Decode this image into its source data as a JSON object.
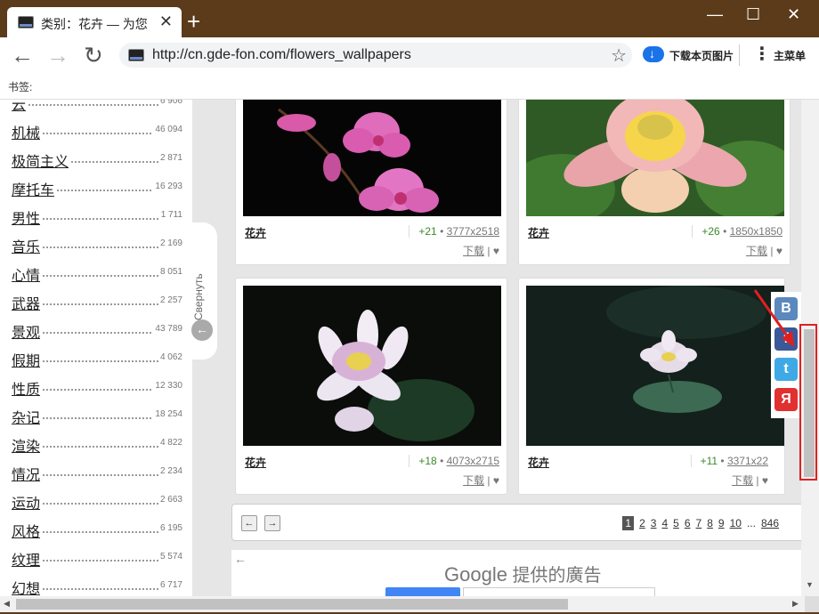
{
  "window": {
    "tab_title": "类别：花卉 — 为您",
    "tab_close": "✕",
    "new_tab": "+",
    "minimize": "—",
    "maximize": "☐",
    "close": "✕"
  },
  "toolbar": {
    "back": "←",
    "forward": "→",
    "reload": "↻",
    "url": "http://cn.gde-fon.com/flowers_wallpapers",
    "star": "☆",
    "download_label": "下载本页图片",
    "menu_label": "主菜单"
  },
  "bookmarks_label": "书签:",
  "sidebar": {
    "collapse_label": "Свернуть",
    "categories": [
      {
        "name": "云",
        "count": "6 906"
      },
      {
        "name": "机械",
        "count": "46 094"
      },
      {
        "name": "极简主义",
        "count": "2 871"
      },
      {
        "name": "摩托车",
        "count": "16 293"
      },
      {
        "name": "男性",
        "count": "1 711"
      },
      {
        "name": "音乐",
        "count": "2 169"
      },
      {
        "name": "心情",
        "count": "8 051"
      },
      {
        "name": "武器",
        "count": "2 257"
      },
      {
        "name": "景观",
        "count": "43 789"
      },
      {
        "name": "假期",
        "count": "4 062"
      },
      {
        "name": "性质",
        "count": "12 330"
      },
      {
        "name": "杂记",
        "count": "18 254"
      },
      {
        "name": "渲染",
        "count": "4 822"
      },
      {
        "name": "情况",
        "count": "2 234"
      },
      {
        "name": "运动",
        "count": "2 663"
      },
      {
        "name": "风格",
        "count": "6 195"
      },
      {
        "name": "纹理",
        "count": "5 574"
      },
      {
        "name": "幻想",
        "count": "6 717"
      }
    ]
  },
  "cards": [
    {
      "name": "花卉",
      "votes": "+21",
      "resolution": "3777x2518",
      "download": "下载",
      "sep": "|",
      "like": "♥"
    },
    {
      "name": "花卉",
      "votes": "+26",
      "resolution": "1850x1850",
      "download": "下载",
      "sep": "|",
      "like": "♥"
    },
    {
      "name": "花卉",
      "votes": "+18",
      "resolution": "4073x2715",
      "download": "下载",
      "sep": "|",
      "like": "♥"
    },
    {
      "name": "花卉",
      "votes": "+11",
      "resolution": "3371x22",
      "download": "下载",
      "sep": "|",
      "like": "♥"
    }
  ],
  "pager": {
    "prev": "←",
    "next": "→",
    "pages": [
      "1",
      "2",
      "3",
      "4",
      "5",
      "6",
      "7",
      "8",
      "9",
      "10"
    ],
    "ellipsis": "...",
    "last": "846"
  },
  "ad": {
    "back": "←",
    "google": "Google",
    "tagline": "提供的廣告"
  },
  "social": [
    {
      "label": "B",
      "color": "#5b88bd"
    },
    {
      "label": "f",
      "color": "#3b5998"
    },
    {
      "label": "t",
      "color": "#3fa9e6"
    },
    {
      "label": "Я",
      "color": "#e03030"
    }
  ]
}
